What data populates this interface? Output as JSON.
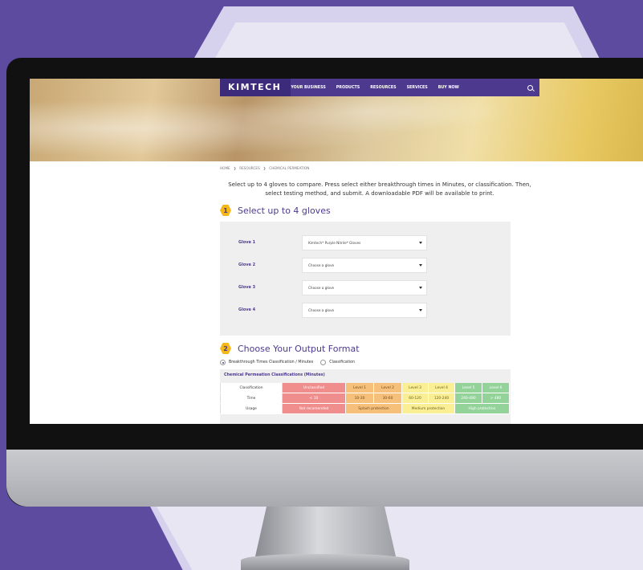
{
  "nav": {
    "logo": "KIMTECH",
    "items": [
      "YOUR BUSINESS",
      "PRODUCTS",
      "RESOURCES",
      "SERVICES",
      "BUY NOW"
    ]
  },
  "breadcrumb": [
    "HOME",
    "RESOURCES",
    "CHEMICAL PERMEATION"
  ],
  "breadcrumb_sep": "❯",
  "intro": "Select up to 4 gloves to compare. Press select either breakthrough times in Minutes, or classification. Then, select testing method, and submit. A downloadable PDF will be available to print.",
  "step1": {
    "num": "1",
    "title": "Select up to 4 gloves"
  },
  "gloves": [
    {
      "label": "Glove 1",
      "value": "Kimtech* Purple Nitrile* Gloves"
    },
    {
      "label": "Glove 2",
      "value": "Choose a glove"
    },
    {
      "label": "Glove 3",
      "value": "Choose a glove"
    },
    {
      "label": "Glove 4",
      "value": "Choose a glove"
    }
  ],
  "step2": {
    "num": "2",
    "title": "Choose Your Output Format"
  },
  "output_options": [
    "Breakthrough Times Classification / Minutes",
    "Classification"
  ],
  "table": {
    "title": "Chemical Permeation Classifications (Minutes)",
    "classification_row": [
      "Classification",
      "Unclassified",
      "Level 1",
      "Level 2",
      "Level 3",
      "Level 4",
      "Level 5",
      "Level 6"
    ],
    "time_row": [
      "Time",
      "< 10",
      "10-30",
      "30-60",
      "60-120",
      "120-240",
      "240-480",
      "> 480"
    ],
    "usage_row": [
      "Usage",
      "Not recomended",
      "Splash protection",
      "Medium protection",
      "High protection"
    ]
  },
  "colors": {
    "brand_purple": "#4d3a8f",
    "accent_yellow": "#f5b81b",
    "background": "#5c4b9f"
  }
}
